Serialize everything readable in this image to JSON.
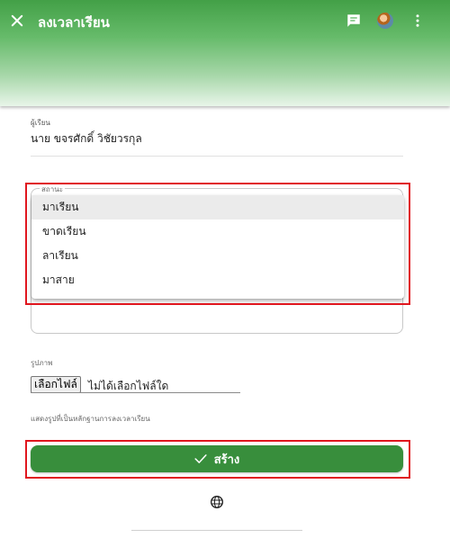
{
  "appbar": {
    "title": "ลงเวลาเรียน",
    "icons": {
      "close": "close-icon",
      "chat": "chat-icon",
      "avatar": "avatar",
      "more": "more-vert-icon"
    },
    "accent_color": "#43a047"
  },
  "student": {
    "label": "ผู้เรียน",
    "value": "นาย ขจรศักดิ์ วิชัยวรกุล"
  },
  "status": {
    "label": "สถานะ",
    "options": [
      "มาเรียน",
      "ขาดเรียน",
      "ลาเรียน",
      "มาสาย"
    ],
    "highlighted_option": "มาเรียน"
  },
  "image": {
    "label": "รูปภาพ",
    "choose_file_label": "เลือกไฟล์",
    "no_file_text": "ไม่ได้เลือกไฟล์ใด"
  },
  "hint": "แสดงรูปที่เป็นหลักฐานการลงเวลาเรียน",
  "create_button": {
    "label": "สร้าง",
    "icon": "check-icon",
    "color": "#388e3c"
  },
  "footer": {
    "icon": "globe-icon"
  },
  "highlight_color": "#e0161e"
}
